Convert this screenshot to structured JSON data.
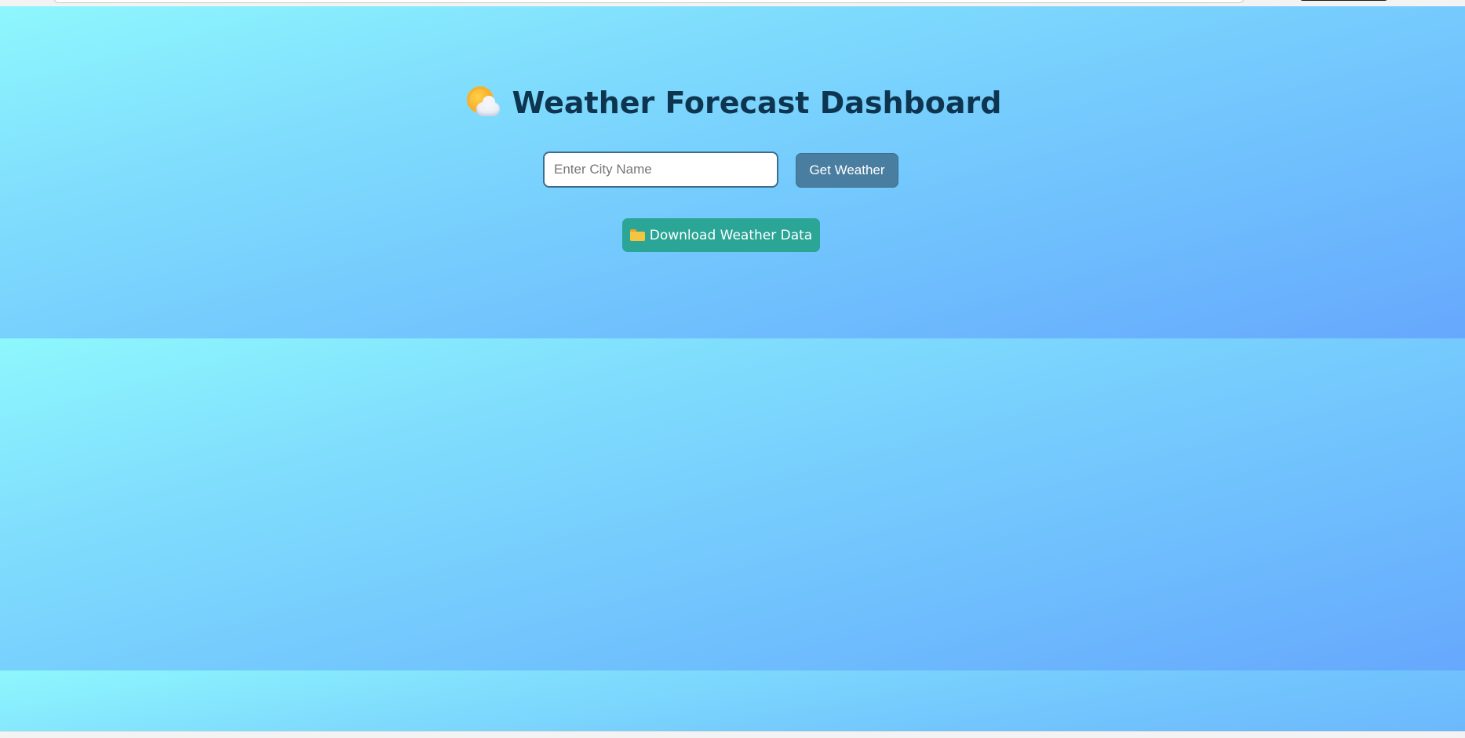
{
  "header": {
    "title": "Weather Forecast Dashboard",
    "title_icon": "sun-behind-cloud-icon"
  },
  "search": {
    "placeholder": "Enter City Name",
    "value": "",
    "button_label": "Get Weather"
  },
  "download": {
    "icon": "folder-icon",
    "label": "Download Weather Data"
  },
  "colors": {
    "gradient_start": "#8ef7fd",
    "gradient_end": "#66a8fd",
    "title_text": "#0e3550",
    "get_weather_button": "#4a7ea0",
    "download_button": "#2aa596"
  }
}
